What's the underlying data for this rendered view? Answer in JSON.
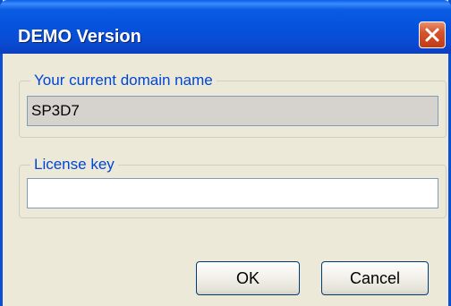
{
  "window": {
    "title": "DEMO Version"
  },
  "domain_group": {
    "label": "Your current domain name",
    "value": "SP3D7"
  },
  "license_group": {
    "label": "License key",
    "value": ""
  },
  "buttons": {
    "ok_label": "OK",
    "cancel_label": "Cancel"
  },
  "icons": {
    "close": "close-icon"
  },
  "colors": {
    "titlebar": "#0551dc",
    "group_label": "#0046d5",
    "dialog_background": "#ece9d8",
    "readonly_field": "#d6d3ce",
    "close_button": "#d5542d"
  }
}
